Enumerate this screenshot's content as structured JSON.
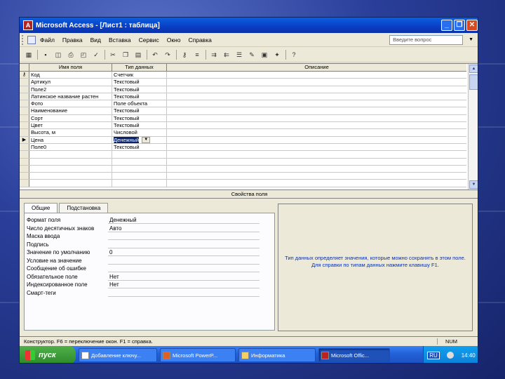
{
  "window": {
    "title": "Microsoft Access - [Лист1 : таблица]",
    "app_icon_glyph": "A",
    "controls": [
      "_",
      "❐",
      "✕"
    ]
  },
  "menu": {
    "items": [
      "Файл",
      "Правка",
      "Вид",
      "Вставка",
      "Сервис",
      "Окно",
      "Справка"
    ],
    "help_placeholder": "Введите вопрос"
  },
  "grid": {
    "headers": [
      "Имя поля",
      "Тип данных",
      "Описание"
    ],
    "rows": [
      {
        "selector": "⚷",
        "name": "Код",
        "type": "Счетчик",
        "desc": ""
      },
      {
        "selector": "",
        "name": "Артикул",
        "type": "Текстовый",
        "desc": ""
      },
      {
        "selector": "",
        "name": "Поле2",
        "type": "Текстовый",
        "desc": ""
      },
      {
        "selector": "",
        "name": "Латинское название растен",
        "type": "Текстовый",
        "desc": ""
      },
      {
        "selector": "",
        "name": "Фото",
        "type": "Поле объекта",
        "desc": ""
      },
      {
        "selector": "",
        "name": "Наименование",
        "type": "Текстовый",
        "desc": ""
      },
      {
        "selector": "",
        "name": "Сорт",
        "type": "Текстовый",
        "desc": ""
      },
      {
        "selector": "",
        "name": "Цвет",
        "type": "Текстовый",
        "desc": ""
      },
      {
        "selector": "",
        "name": "Высота, м",
        "type": "Числовой",
        "desc": ""
      },
      {
        "selector": "▶",
        "name": "Цена",
        "type": "Денежный",
        "desc": ""
      },
      {
        "selector": "",
        "name": "Поле0",
        "type": "Текстовый",
        "desc": ""
      },
      {
        "selector": "",
        "name": "",
        "type": "",
        "desc": ""
      },
      {
        "selector": "",
        "name": "",
        "type": "",
        "desc": ""
      },
      {
        "selector": "",
        "name": "",
        "type": "",
        "desc": ""
      },
      {
        "selector": "",
        "name": "",
        "type": "",
        "desc": ""
      },
      {
        "selector": "",
        "name": "",
        "type": "",
        "desc": ""
      }
    ]
  },
  "properties": {
    "label": "Свойства поля",
    "tabs": [
      "Общие",
      "Подстановка"
    ],
    "rows": [
      {
        "label": "Формат поля",
        "value": "Денежный"
      },
      {
        "label": "Число десятичных знаков",
        "value": "Авто"
      },
      {
        "label": "Маска ввода",
        "value": ""
      },
      {
        "label": "Подпись",
        "value": ""
      },
      {
        "label": "Значение по умолчанию",
        "value": "0"
      },
      {
        "label": "Условие на значение",
        "value": ""
      },
      {
        "label": "Сообщение об ошибке",
        "value": ""
      },
      {
        "label": "Обязательное поле",
        "value": "Нет"
      },
      {
        "label": "Индексированное поле",
        "value": "Нет"
      },
      {
        "label": "Смарт-теги",
        "value": ""
      }
    ],
    "help_text": "Тип данных определяет значения, которые можно сохранять в этом поле. Для справки по типам данных нажмите клавишу F1."
  },
  "status": {
    "text": "Конструктор. F6 = переключение окон. F1 = справка.",
    "num": "NUM"
  },
  "taskbar": {
    "start": "пуск",
    "tasks": [
      "Добавление ключу...",
      "Microsoft PowerP...",
      "Информатика",
      "Microsoft Offic..."
    ],
    "lang": "RU",
    "time": "14:40"
  },
  "colors": {
    "titlebar": "#0a3ec4",
    "selection": "#0a246a",
    "help_text": "#0a32a8"
  }
}
